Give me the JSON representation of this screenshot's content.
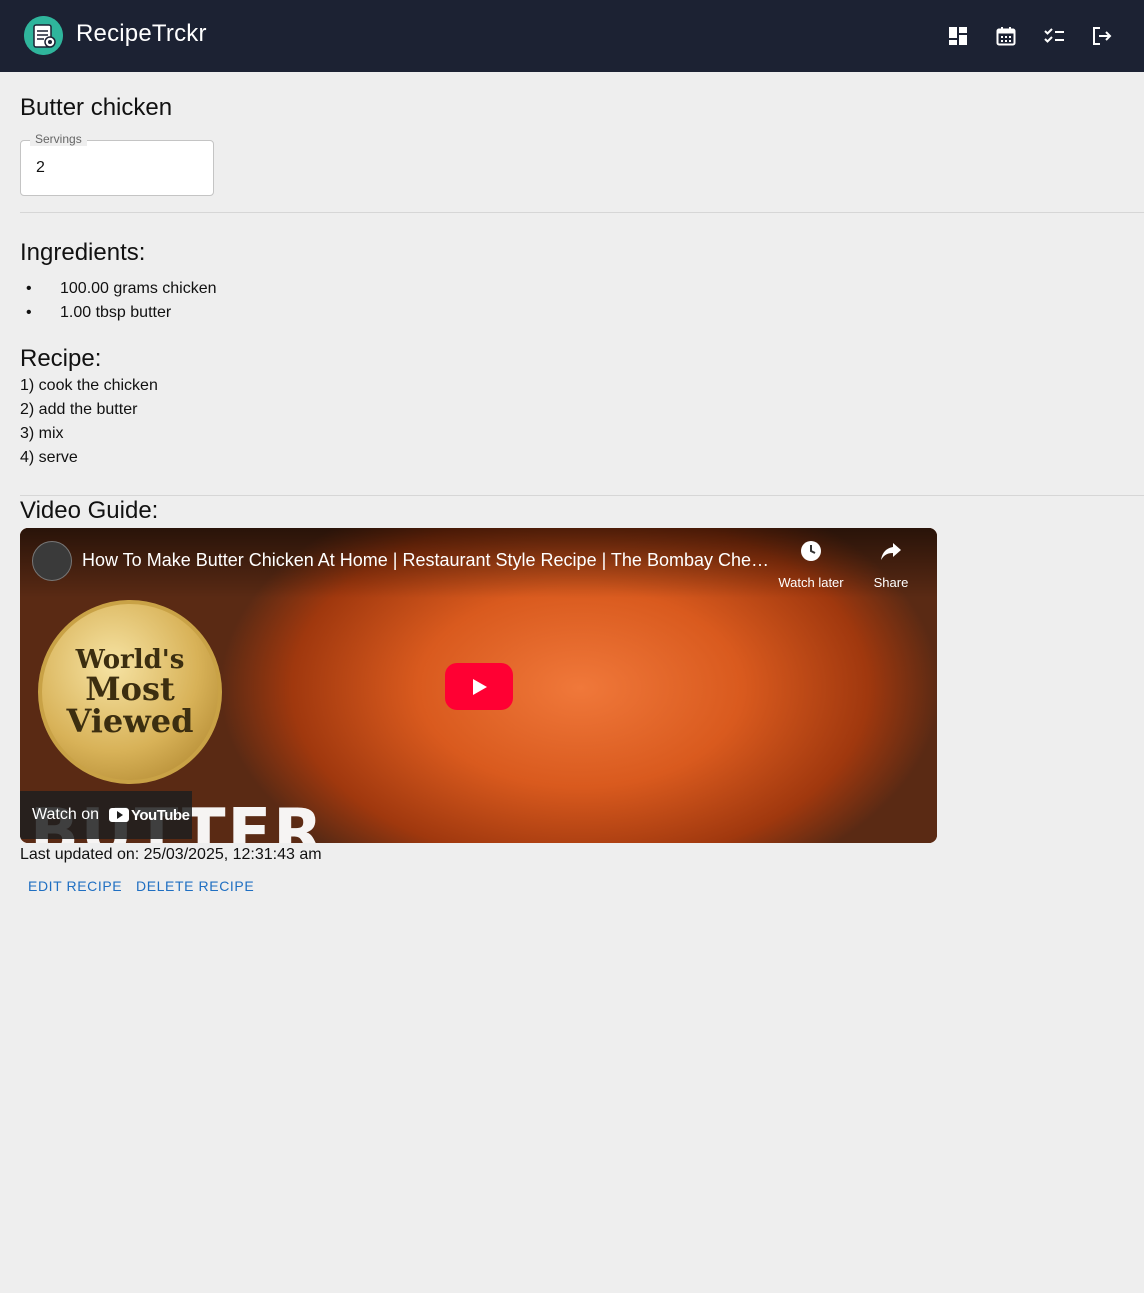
{
  "header": {
    "app_title": "RecipeTrckr",
    "icons": [
      "dashboard-icon",
      "calendar-icon",
      "checklist-icon",
      "logout-icon"
    ]
  },
  "recipe": {
    "title": "Butter chicken",
    "servings_label": "Servings",
    "servings_value": "2",
    "ingredients_heading": "Ingredients:",
    "ingredients": [
      "100.00 grams chicken",
      "1.00 tbsp butter"
    ],
    "recipe_heading": "Recipe:",
    "steps": [
      "1) cook the chicken",
      "2) add the butter",
      "3) mix",
      "4) serve"
    ],
    "video_heading": "Video Guide:",
    "last_updated": "Last updated on: 25/03/2025, 12:31:43 am"
  },
  "video": {
    "title": "How To Make Butter Chicken At Home | Restaurant Style Recipe | The Bombay Chef ...",
    "watch_later": "Watch later",
    "share": "Share",
    "watch_on": "Watch on",
    "youtube": "YouTube",
    "badge_line1": "World's",
    "badge_line2": "Most",
    "badge_line3": "Viewed",
    "overlay_text": "BUTTER"
  },
  "actions": {
    "edit": "EDIT RECIPE",
    "delete": "DELETE RECIPE"
  },
  "colors": {
    "appbar": "#1c2233",
    "background": "#eeeeee",
    "link": "#1f6fc2",
    "play_button": "#ff0033"
  }
}
